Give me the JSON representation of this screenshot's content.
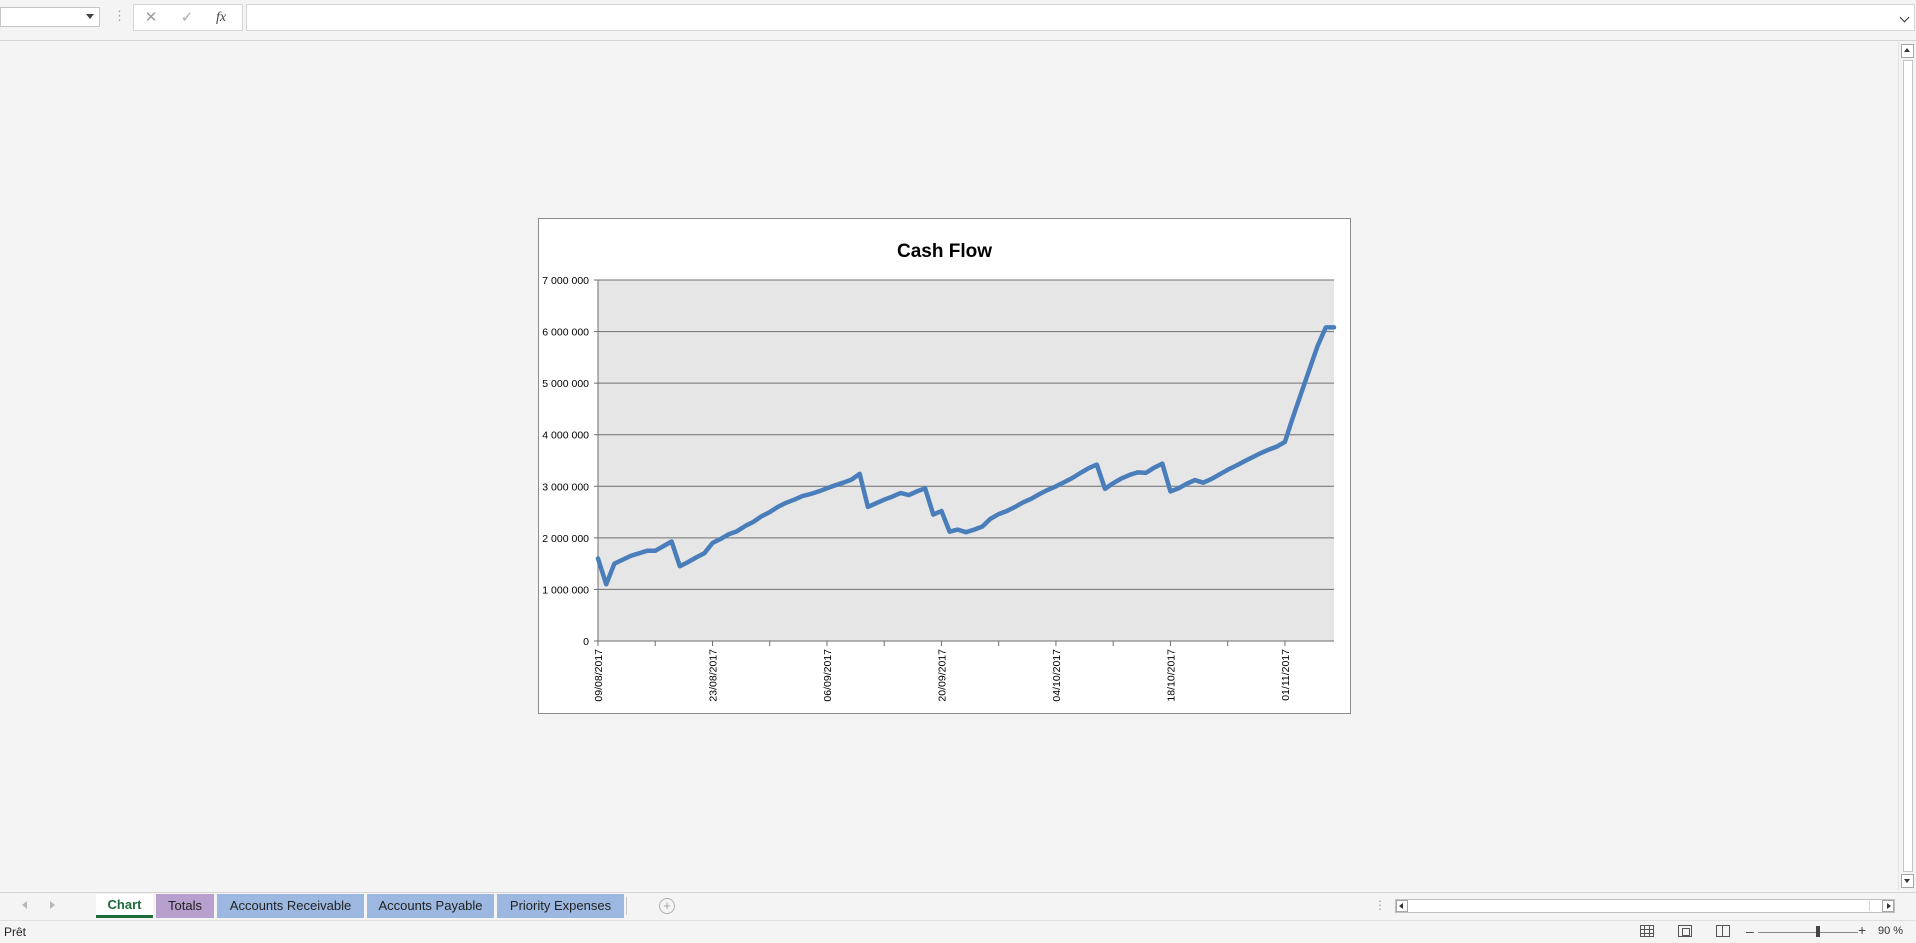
{
  "formula_bar": {
    "name_box_value": "",
    "formula_value": "",
    "cancel_icon": "cancel-icon",
    "enter_icon": "enter-icon",
    "fx_label": "fx"
  },
  "chart_data": {
    "type": "line",
    "title": "Cash Flow",
    "xlabel": "",
    "ylabel": "",
    "ylim": [
      0,
      7000000
    ],
    "y_ticks": [
      0,
      1000000,
      2000000,
      3000000,
      4000000,
      5000000,
      6000000,
      7000000
    ],
    "y_tick_labels": [
      "0",
      "1 000 000",
      "2 000 000",
      "3 000 000",
      "4 000 000",
      "5 000 000",
      "6 000 000",
      "7 000 000"
    ],
    "x_tick_labels": [
      "09/08/2017",
      "23/08/2017",
      "06/09/2017",
      "20/09/2017",
      "04/10/2017",
      "18/10/2017",
      "01/11/2017"
    ],
    "x_start": "09/08/2017",
    "x_end": "07/11/2017",
    "grid": true,
    "legend": "none",
    "line_color": "#4a7ebb",
    "plot_bg": "#e6e6e6",
    "series": [
      {
        "x": [
          "09/08/2017",
          "10/08/2017",
          "11/08/2017",
          "13/08/2017",
          "15/08/2017",
          "16/08/2017",
          "18/08/2017",
          "19/08/2017",
          "20/08/2017",
          "21/08/2017",
          "22/08/2017",
          "23/08/2017",
          "24/08/2017",
          "25/08/2017",
          "26/08/2017",
          "27/08/2017",
          "28/08/2017",
          "29/08/2017",
          "30/08/2017",
          "31/08/2017",
          "01/09/2017",
          "02/09/2017",
          "03/09/2017",
          "04/09/2017",
          "05/09/2017",
          "06/09/2017",
          "07/09/2017",
          "08/09/2017",
          "09/09/2017",
          "10/09/2017",
          "11/09/2017",
          "12/09/2017",
          "13/09/2017",
          "14/09/2017",
          "15/09/2017",
          "16/09/2017",
          "17/09/2017",
          "18/09/2017",
          "19/09/2017",
          "20/09/2017",
          "21/09/2017",
          "22/09/2017",
          "23/09/2017",
          "24/09/2017",
          "25/09/2017",
          "26/09/2017",
          "27/09/2017",
          "28/09/2017",
          "29/09/2017",
          "30/09/2017",
          "01/10/2017",
          "02/10/2017",
          "03/10/2017",
          "04/10/2017",
          "05/10/2017",
          "06/10/2017",
          "07/10/2017",
          "08/10/2017",
          "09/10/2017",
          "10/10/2017",
          "11/10/2017",
          "12/10/2017",
          "13/10/2017",
          "14/10/2017",
          "15/10/2017",
          "16/10/2017",
          "17/10/2017",
          "18/10/2017",
          "19/10/2017",
          "20/10/2017",
          "21/10/2017",
          "22/10/2017",
          "23/10/2017",
          "24/10/2017",
          "25/10/2017",
          "26/10/2017",
          "27/10/2017",
          "28/10/2017",
          "29/10/2017",
          "30/10/2017",
          "31/10/2017",
          "01/11/2017",
          "02/11/2017",
          "03/11/2017",
          "04/11/2017",
          "05/11/2017",
          "06/11/2017",
          "07/11/2017"
        ],
        "values": [
          1600000,
          1100000,
          1500000,
          1650000,
          1750000,
          1750000,
          1930000,
          1450000,
          1530000,
          1620000,
          1700000,
          1900000,
          1980000,
          2070000,
          2130000,
          2230000,
          2310000,
          2420000,
          2500000,
          2600000,
          2680000,
          2740000,
          2810000,
          2850000,
          2900000,
          2960000,
          3020000,
          3070000,
          3130000,
          3240000,
          2600000,
          2670000,
          2740000,
          2800000,
          2870000,
          2830000,
          2900000,
          2960000,
          2450000,
          2520000,
          2120000,
          2160000,
          2110000,
          2160000,
          2220000,
          2370000,
          2460000,
          2520000,
          2600000,
          2690000,
          2760000,
          2850000,
          2930000,
          3000000,
          3080000,
          3160000,
          3260000,
          3350000,
          3420000,
          2950000,
          3060000,
          3150000,
          3220000,
          3270000,
          3260000,
          3360000,
          3440000,
          2900000,
          2960000,
          3050000,
          3120000,
          3070000,
          3140000,
          3230000,
          3320000,
          3400000,
          3480000,
          3560000,
          3640000,
          3710000,
          3770000,
          3860000,
          4350000,
          4810000,
          5270000,
          5720000,
          6080000,
          6080000
        ]
      }
    ]
  },
  "sheet_tabs": [
    {
      "label": "Chart",
      "active": true
    },
    {
      "label": "Totals"
    },
    {
      "label": "Accounts Receivable"
    },
    {
      "label": "Accounts Payable"
    },
    {
      "label": "Priority Expenses"
    }
  ],
  "status_bar": {
    "status_text": "Prêt",
    "zoom_label": "90 %",
    "zoom_percent": 90
  }
}
